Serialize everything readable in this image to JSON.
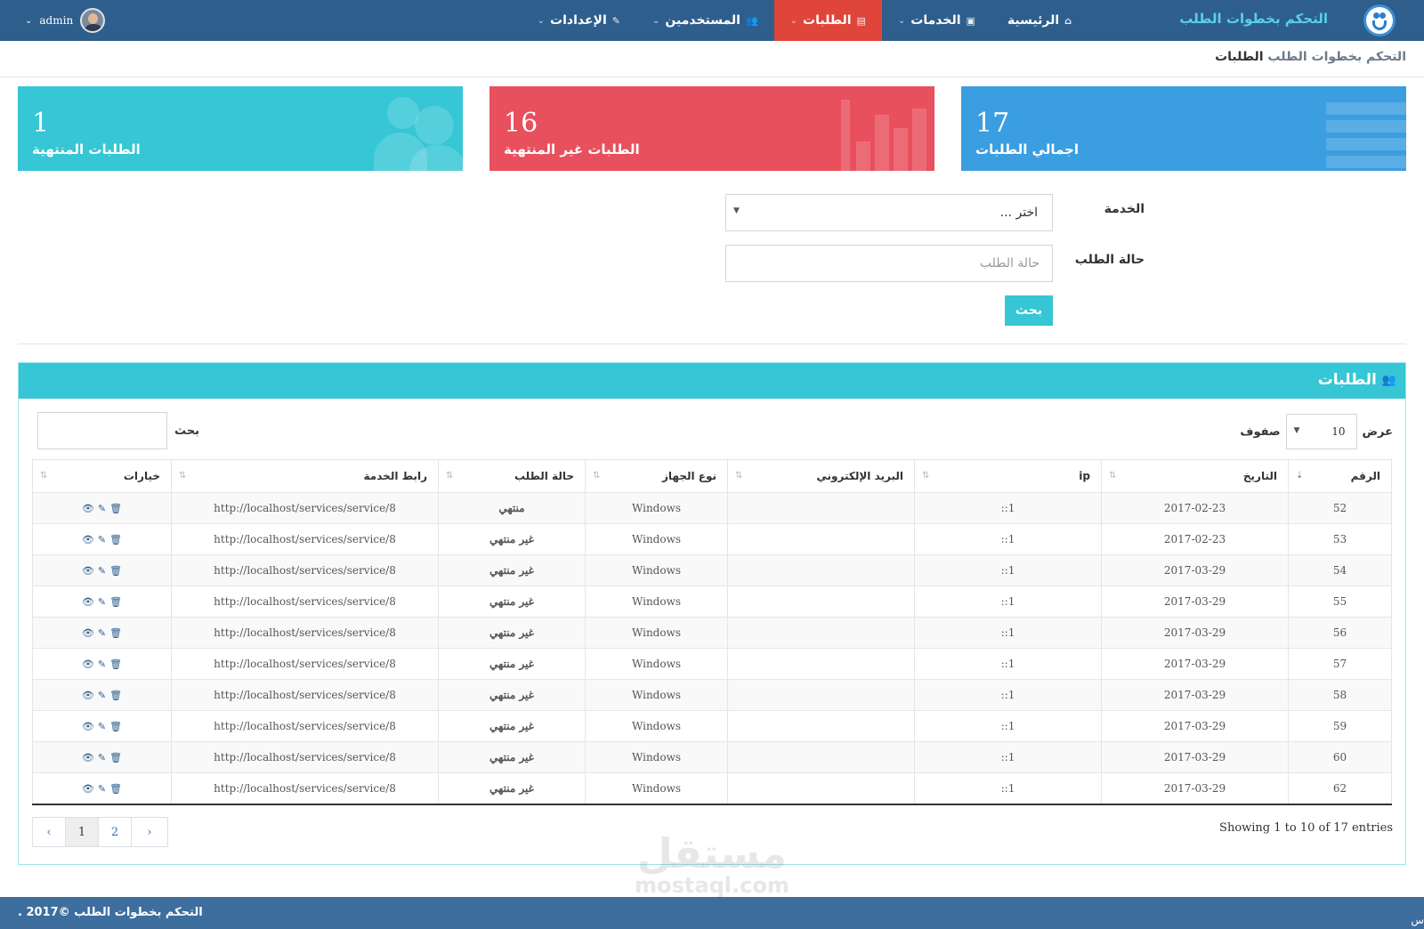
{
  "nav": {
    "brand": "التحكم بخطوات الطلب",
    "items": [
      {
        "label": "الرئيسية",
        "icon": "⌂"
      },
      {
        "label": "الخدمات",
        "icon": "▣"
      },
      {
        "label": "الطلبات",
        "icon": "▤"
      },
      {
        "label": "المستخدمين",
        "icon": "👥"
      },
      {
        "label": "الإعدادات",
        "icon": "✎"
      }
    ],
    "active_index": 2,
    "user": "admin"
  },
  "breadcrumb": {
    "parent": "التحكم بخطوات الطلب",
    "current": "الطلبات"
  },
  "stats": {
    "total": {
      "value": "17",
      "label": "اجمالي الطلبات"
    },
    "unfinished": {
      "value": "16",
      "label": "الطلبات غير المنتهية"
    },
    "finished": {
      "value": "1",
      "label": "الطلبات المنتهية"
    }
  },
  "filter": {
    "service_label": "الخدمة",
    "service_value": "اختر ...",
    "status_label": "حالة الطلب",
    "status_placeholder": "حالة الطلب",
    "search_button": "بحث"
  },
  "panel": {
    "title": "الطلبات",
    "length_prefix": "عرض",
    "length_value": "10",
    "length_suffix": "صفوف",
    "search_label": "بحث"
  },
  "table": {
    "headers": [
      "الرقم",
      "التاريخ",
      "ip",
      "البريد الإلكتروني",
      "نوع الجهاز",
      "حالة الطلب",
      "رابط الخدمة",
      "خيارات"
    ],
    "rows": [
      {
        "id": "52",
        "date": "2017-02-23",
        "ip": "::1",
        "email": "",
        "device": "Windows",
        "status": "منتهي",
        "link": "http://localhost/services/service/8"
      },
      {
        "id": "53",
        "date": "2017-02-23",
        "ip": "::1",
        "email": "",
        "device": "Windows",
        "status": "غير منتهي",
        "link": "http://localhost/services/service/8"
      },
      {
        "id": "54",
        "date": "2017-03-29",
        "ip": "::1",
        "email": "",
        "device": "Windows",
        "status": "غير منتهي",
        "link": "http://localhost/services/service/8"
      },
      {
        "id": "55",
        "date": "2017-03-29",
        "ip": "::1",
        "email": "",
        "device": "Windows",
        "status": "غير منتهي",
        "link": "http://localhost/services/service/8"
      },
      {
        "id": "56",
        "date": "2017-03-29",
        "ip": "::1",
        "email": "",
        "device": "Windows",
        "status": "غير منتهي",
        "link": "http://localhost/services/service/8"
      },
      {
        "id": "57",
        "date": "2017-03-29",
        "ip": "::1",
        "email": "",
        "device": "Windows",
        "status": "غير منتهي",
        "link": "http://localhost/services/service/8"
      },
      {
        "id": "58",
        "date": "2017-03-29",
        "ip": "::1",
        "email": "",
        "device": "Windows",
        "status": "غير منتهي",
        "link": "http://localhost/services/service/8"
      },
      {
        "id": "59",
        "date": "2017-03-29",
        "ip": "::1",
        "email": "",
        "device": "Windows",
        "status": "غير منتهي",
        "link": "http://localhost/services/service/8"
      },
      {
        "id": "60",
        "date": "2017-03-29",
        "ip": "::1",
        "email": "",
        "device": "Windows",
        "status": "غير منتهي",
        "link": "http://localhost/services/service/8"
      },
      {
        "id": "62",
        "date": "2017-03-29",
        "ip": "::1",
        "email": "",
        "device": "Windows",
        "status": "غير منتهي",
        "link": "http://localhost/services/service/8"
      }
    ],
    "info": "Showing 1 to 10 of 17 entries",
    "pages": [
      "‹",
      "1",
      "2",
      "›"
    ],
    "current_page": "1"
  },
  "footer": {
    "text": "التحكم بخطوات الطلب ©2017 .",
    "fragment": "س"
  },
  "watermark": {
    "ar": "مستقل",
    "en": "mostaql.com"
  },
  "colors": {
    "navbar": "#2e5e8c",
    "active": "#e0453a",
    "blue": "#3b9ee0",
    "red": "#e8505d",
    "cyan": "#36c6d6",
    "footer": "#3d6e9e"
  }
}
